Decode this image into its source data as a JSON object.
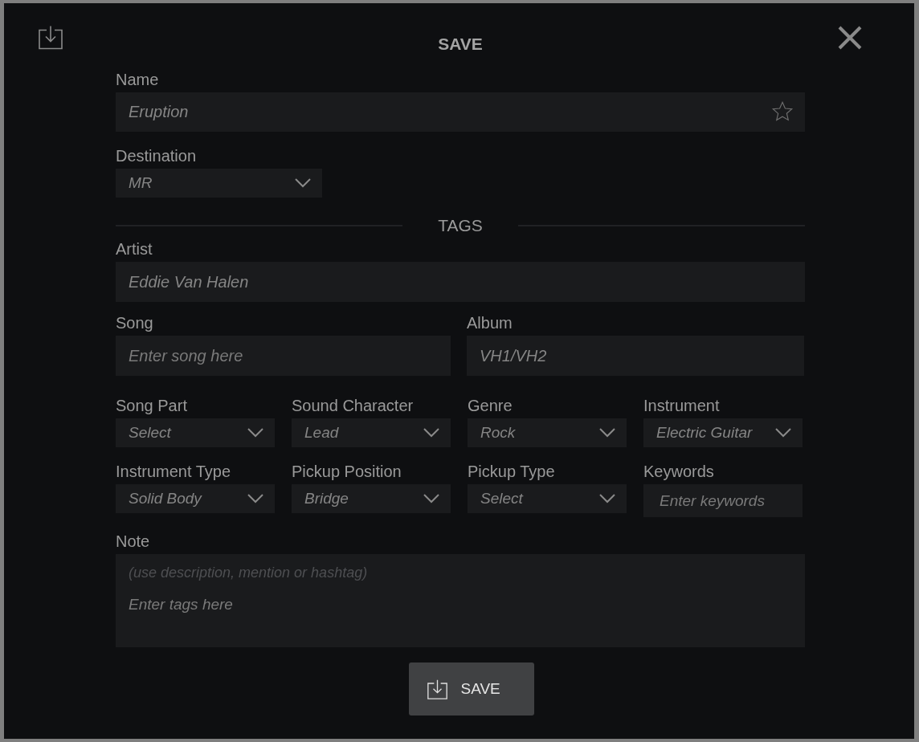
{
  "dialog": {
    "title": "SAVE"
  },
  "name": {
    "label": "Name",
    "value": "Eruption",
    "starred": false
  },
  "destination": {
    "label": "Destination",
    "value": "MR"
  },
  "tags_heading": "TAGS",
  "artist": {
    "label": "Artist",
    "value": "Eddie Van Halen"
  },
  "song_row": [
    {
      "label": "Song",
      "placeholder": "Enter song here"
    },
    {
      "label": "Album",
      "value": "VH1/VH2"
    }
  ],
  "selectors": [
    {
      "kind": "dropdown",
      "label": "Song Part",
      "value": "Select"
    },
    {
      "kind": "dropdown",
      "label": "Sound Character",
      "value": "Lead"
    },
    {
      "kind": "dropdown",
      "label": "Genre",
      "value": "Rock"
    },
    {
      "kind": "dropdown",
      "label": "Instrument",
      "value": "Electric Guitar"
    },
    {
      "kind": "dropdown",
      "label": "Instrument Type",
      "value": "Solid Body"
    },
    {
      "kind": "dropdown",
      "label": "Pickup Position",
      "value": "Bridge"
    },
    {
      "kind": "dropdown",
      "label": "Pickup Type",
      "value": "Select"
    },
    {
      "kind": "text",
      "label": "Keywords",
      "placeholder": "Enter keywords"
    }
  ],
  "note": {
    "label": "Note",
    "hint": "(use description, mention or hashtag)",
    "placeholder": "Enter tags here"
  },
  "save_button": {
    "label": "SAVE"
  }
}
